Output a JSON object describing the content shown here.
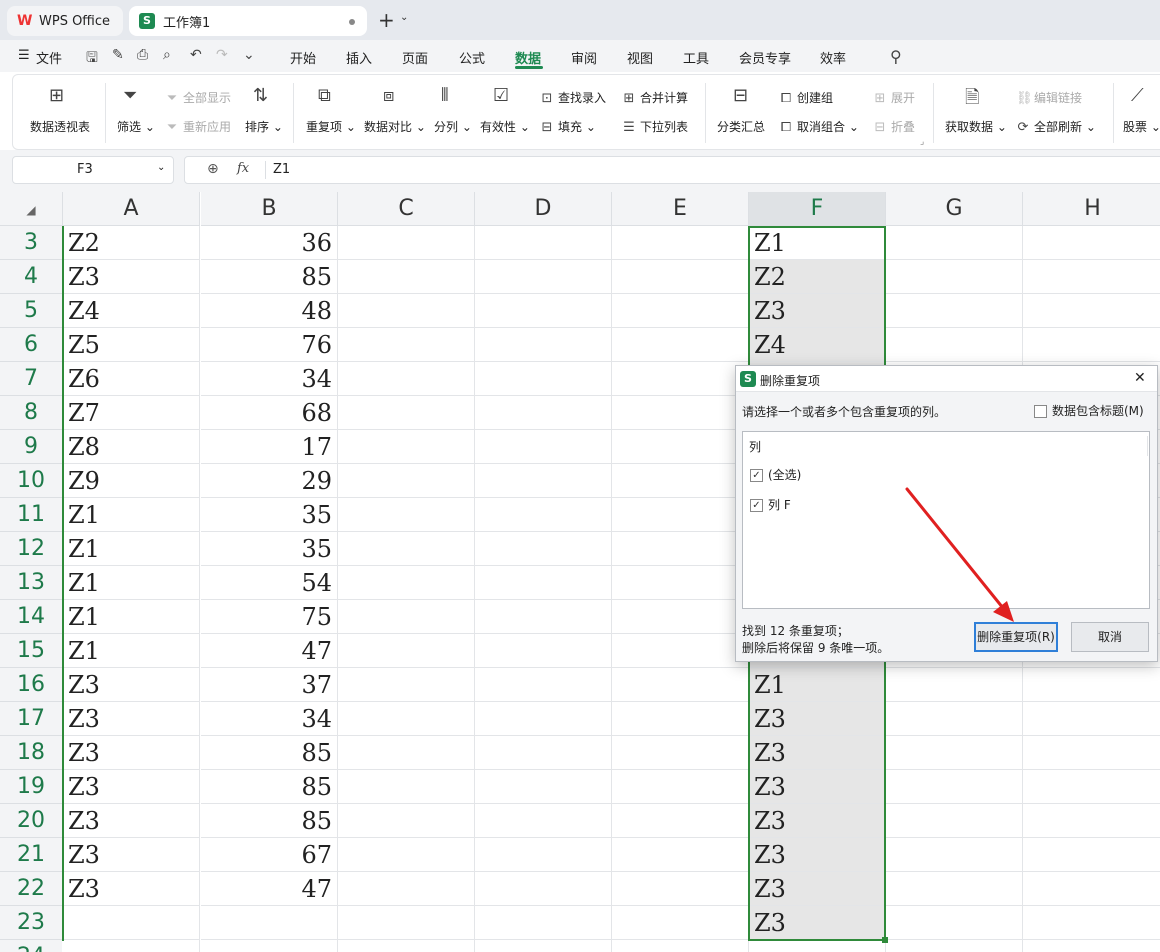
{
  "tabs": {
    "app": {
      "label": "WPS Office"
    },
    "workbook": {
      "label": "工作簿1",
      "badge": "S"
    }
  },
  "menu": {
    "file": "文件",
    "items": [
      "开始",
      "插入",
      "页面",
      "公式",
      "数据",
      "审阅",
      "视图",
      "工具",
      "会员专享",
      "效率"
    ],
    "active": "数据"
  },
  "ribbon": {
    "pivot": "数据透视表",
    "filter": "筛选",
    "show_all": "全部显示",
    "reapply": "重新应用",
    "sort": "排序",
    "duplicates": "重复项",
    "compare": "数据对比",
    "split": "分列",
    "validity": "有效性",
    "lookup_entry": "查找录入",
    "fill": "填充",
    "consolidate": "合并计算",
    "dropdown_list": "下拉列表",
    "subtotal": "分类汇总",
    "create_group": "创建组",
    "ungroup": "取消组合",
    "expand": "展开",
    "collapse": "折叠",
    "get_data": "获取数据",
    "edit_links": "编辑链接",
    "refresh_all": "全部刷新",
    "stocks": "股票"
  },
  "formula_bar": {
    "name_box": "F3",
    "fx": "fx",
    "content": "Z1"
  },
  "grid": {
    "corner": "◢",
    "columns": [
      "A",
      "B",
      "C",
      "D",
      "E",
      "F",
      "G",
      "H"
    ],
    "selected_column": "F",
    "rows": [
      {
        "n": "3",
        "a": "Z2",
        "b": "36",
        "f": "Z1"
      },
      {
        "n": "4",
        "a": "Z3",
        "b": "85",
        "f": "Z2"
      },
      {
        "n": "5",
        "a": "Z4",
        "b": "48",
        "f": "Z3"
      },
      {
        "n": "6",
        "a": "Z5",
        "b": "76",
        "f": "Z4"
      },
      {
        "n": "7",
        "a": "Z6",
        "b": "34",
        "f": ""
      },
      {
        "n": "8",
        "a": "Z7",
        "b": "68",
        "f": ""
      },
      {
        "n": "9",
        "a": "Z8",
        "b": "17",
        "f": ""
      },
      {
        "n": "10",
        "a": "Z9",
        "b": "29",
        "f": ""
      },
      {
        "n": "11",
        "a": "Z1",
        "b": "35",
        "f": ""
      },
      {
        "n": "12",
        "a": "Z1",
        "b": "35",
        "f": ""
      },
      {
        "n": "13",
        "a": "Z1",
        "b": "54",
        "f": ""
      },
      {
        "n": "14",
        "a": "Z1",
        "b": "75",
        "f": ""
      },
      {
        "n": "15",
        "a": "Z1",
        "b": "47",
        "f": ""
      },
      {
        "n": "16",
        "a": "Z3",
        "b": "37",
        "f": "Z1"
      },
      {
        "n": "17",
        "a": "Z3",
        "b": "34",
        "f": "Z3"
      },
      {
        "n": "18",
        "a": "Z3",
        "b": "85",
        "f": "Z3"
      },
      {
        "n": "19",
        "a": "Z3",
        "b": "85",
        "f": "Z3"
      },
      {
        "n": "20",
        "a": "Z3",
        "b": "85",
        "f": "Z3"
      },
      {
        "n": "21",
        "a": "Z3",
        "b": "67",
        "f": "Z3"
      },
      {
        "n": "22",
        "a": "Z3",
        "b": "47",
        "f": "Z3"
      },
      {
        "n": "23",
        "a": "",
        "b": "",
        "f": "Z3"
      },
      {
        "n": "24",
        "a": "",
        "b": "",
        "f": ""
      }
    ]
  },
  "dialog": {
    "badge": "S",
    "title": "删除重复项",
    "close": "✕",
    "instruction": "请选择一个或者多个包含重复项的列。",
    "header_checkbox": "数据包含标题(M)",
    "header_checked": false,
    "list_header": "列",
    "options": [
      {
        "label": "(全选)",
        "checked": true
      },
      {
        "label": "列 F",
        "checked": true
      }
    ],
    "summary_line1": "找到 12 条重复项；",
    "summary_line2": "删除后将保留 9 条唯一项。",
    "delete_button": "删除重复项(R)",
    "cancel_button": "取消"
  },
  "colors": {
    "accent": "#1e8a52",
    "selection_border": "#1e7a4a",
    "arrow": "#e02020",
    "focus_button": "#2f7fd8"
  }
}
